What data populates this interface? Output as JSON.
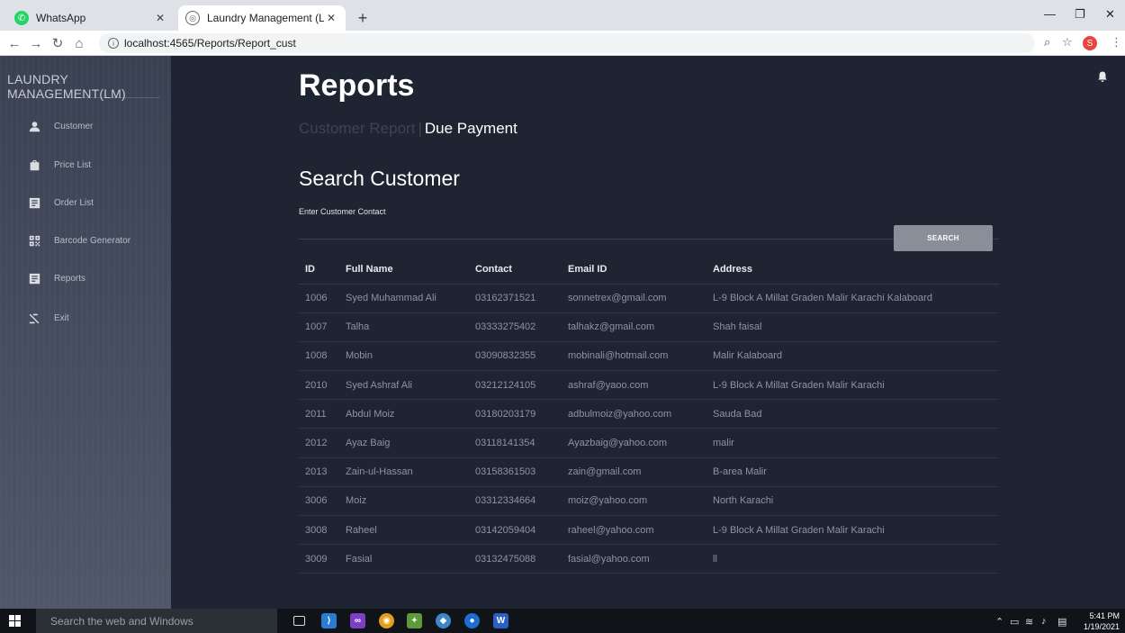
{
  "browser": {
    "tabs": [
      {
        "title": "WhatsApp",
        "active": false
      },
      {
        "title": "Laundry Management (LM)!",
        "active": true
      }
    ],
    "new_tab": "+",
    "url": "localhost:4565/Reports/Report_cust",
    "profile_initial": "S"
  },
  "sidebar": {
    "brand": "LAUNDRY MANAGEMENT(LM)",
    "items": [
      {
        "label": "Customer",
        "icon": "person-icon"
      },
      {
        "label": "Price List",
        "icon": "bag-icon"
      },
      {
        "label": "Order List",
        "icon": "list-icon"
      },
      {
        "label": "Barcode Generator",
        "icon": "qrcode-icon"
      },
      {
        "label": "Reports",
        "icon": "list-icon"
      },
      {
        "label": "Exit",
        "icon": "exit-icon"
      }
    ]
  },
  "main": {
    "title": "Reports",
    "breadcrumb": {
      "customer": "Customer Report",
      "sep": "|",
      "due": "Due Payment"
    },
    "search_heading": "Search Customer",
    "contact_label": "Enter Customer Contact",
    "contact_value": "",
    "search_button": "SEARCH"
  },
  "table": {
    "headers": [
      "ID",
      "Full Name",
      "Contact",
      "Email ID",
      "Address"
    ],
    "rows": [
      [
        "1006",
        "Syed Muhammad Ali",
        "03162371521",
        "sonnetrex@gmail.com",
        "L-9 Block A Millat Graden Malir Karachi Kalaboard"
      ],
      [
        "1007",
        "Talha",
        "03333275402",
        "talhakz@gmail.com",
        "Shah faisal"
      ],
      [
        "1008",
        "Mobin",
        "03090832355",
        "mobinali@hotmail.com",
        "Malir Kalaboard"
      ],
      [
        "2010",
        "Syed Ashraf Ali",
        "03212124105",
        "ashraf@yaoo.com",
        "L-9 Block A Millat Graden Malir Karachi"
      ],
      [
        "2011",
        "Abdul Moiz",
        "03180203179",
        "adbulmoiz@yahoo.com",
        "Sauda Bad"
      ],
      [
        "2012",
        "Ayaz Baig",
        "03118141354",
        "Ayazbaig@yahoo.com",
        "malir"
      ],
      [
        "2013",
        "Zain-ul-Hassan",
        "03158361503",
        "zain@gmail.com",
        "B-area Malir"
      ],
      [
        "3006",
        "Moiz",
        "03312334664",
        "moiz@yahoo.com",
        "North Karachi"
      ],
      [
        "3008",
        "Raheel",
        "03142059404",
        "raheel@yahoo.com",
        "L-9 Block A Millat Graden Malir Karachi"
      ],
      [
        "3009",
        "Fasial",
        "03132475088",
        "fasial@yahoo.com",
        "ll"
      ]
    ]
  },
  "taskbar": {
    "search_placeholder": "Search the web and Windows",
    "time": "5:41 PM",
    "date": "1/19/2021"
  },
  "colors": {
    "main_bg": "#1f2433",
    "sidebar_bg": "#434b5d",
    "button_bg": "#8a8e98",
    "whatsapp": "#25d366"
  }
}
